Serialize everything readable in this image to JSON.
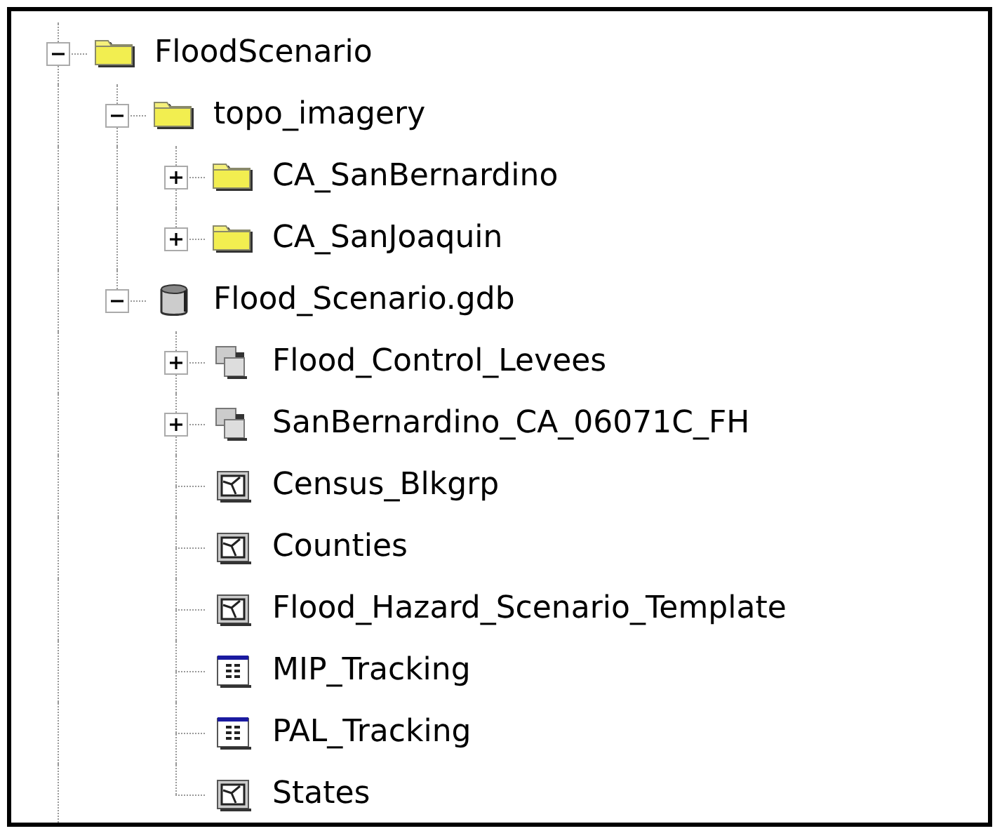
{
  "tree": [
    {
      "label": "FloodScenario",
      "kind": "folder",
      "expanded": true,
      "children": [
        {
          "label": "topo_imagery",
          "kind": "folder",
          "expanded": true,
          "children": [
            {
              "label": "CA_SanBernardino",
              "kind": "folder",
              "expanded": false
            },
            {
              "label": "CA_SanJoaquin",
              "kind": "folder",
              "expanded": false
            }
          ]
        },
        {
          "label": "Flood_Scenario.gdb",
          "kind": "geodatabase",
          "expanded": true,
          "children": [
            {
              "label": "Flood_Control_Levees",
              "kind": "dataset",
              "expanded": false
            },
            {
              "label": "SanBernardino_CA_06071C_FH",
              "kind": "dataset",
              "expanded": false
            },
            {
              "label": "Census_Blkgrp",
              "kind": "featureclass"
            },
            {
              "label": "Counties",
              "kind": "featureclass"
            },
            {
              "label": "Flood_Hazard_Scenario_Template",
              "kind": "featureclass"
            },
            {
              "label": "MIP_Tracking",
              "kind": "table"
            },
            {
              "label": "PAL_Tracking",
              "kind": "table"
            },
            {
              "label": "States",
              "kind": "featureclass"
            }
          ]
        }
      ]
    }
  ]
}
